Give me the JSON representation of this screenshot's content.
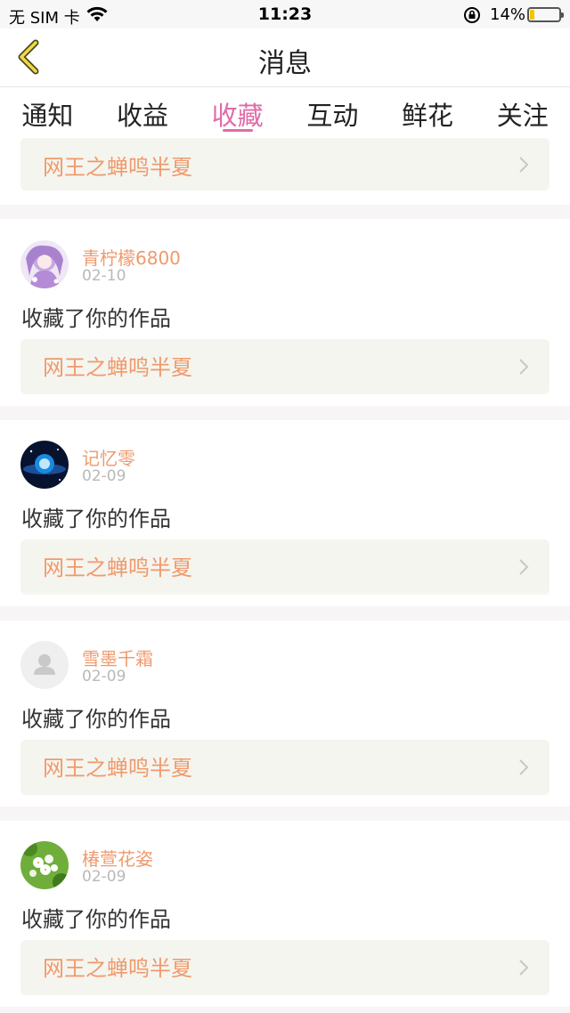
{
  "status_bar": {
    "carrier": "无 SIM 卡",
    "time": "11:23",
    "battery": "14%"
  },
  "header": {
    "title": "消息"
  },
  "tabs": [
    {
      "label": "通知",
      "active": false
    },
    {
      "label": "收益",
      "active": false
    },
    {
      "label": "收藏",
      "active": true
    },
    {
      "label": "互动",
      "active": false
    },
    {
      "label": "鲜花",
      "active": false
    },
    {
      "label": "关注",
      "active": false
    }
  ],
  "top_partial": {
    "work_title": "网王之蝉鸣半夏"
  },
  "items": [
    {
      "username": "青柠檬6800",
      "date": "02-10",
      "action": "收藏了你的作品",
      "work_title": "网王之蝉鸣半夏",
      "avatar": "anime-girl-avatar"
    },
    {
      "username": "记忆零",
      "date": "02-09",
      "action": "收藏了你的作品",
      "work_title": "网王之蝉鸣半夏",
      "avatar": "galaxy-avatar"
    },
    {
      "username": "雪墨千霜",
      "date": "02-09",
      "action": "收藏了你的作品",
      "work_title": "网王之蝉鸣半夏",
      "avatar": "default-user-avatar"
    },
    {
      "username": "椿萱花姿",
      "date": "02-09",
      "action": "收藏了你的作品",
      "work_title": "网王之蝉鸣半夏",
      "avatar": "white-flowers-avatar"
    }
  ],
  "colors": {
    "accent": "#e16ba8",
    "username": "#ef9a6d",
    "work_box_bg": "#f5f5ef"
  }
}
